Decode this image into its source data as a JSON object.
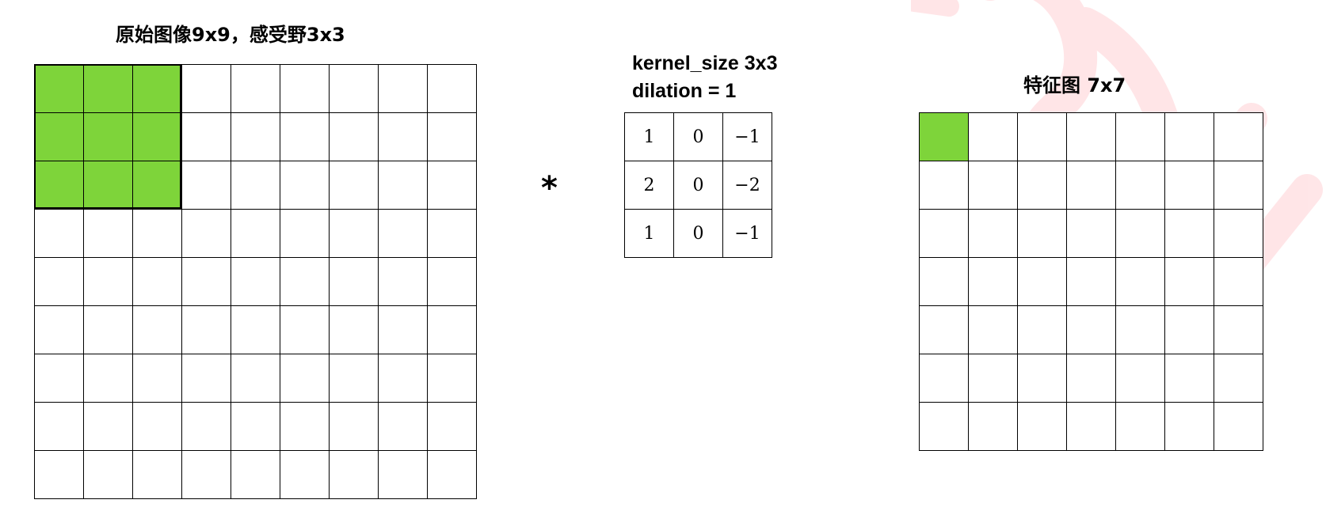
{
  "title_left": "原始图像9x9，感受野3x3",
  "title_right": "特征图 7x7",
  "kernel_size_label": "kernel_size 3x3",
  "dilation_label": "dilation = 1",
  "operator": "*",
  "input_grid": {
    "rows": 9,
    "cols": 9,
    "highlight": {
      "rows": 3,
      "cols": 3
    }
  },
  "kernel_values": [
    [
      "1",
      "0",
      "−1"
    ],
    [
      "2",
      "0",
      "−2"
    ],
    [
      "1",
      "0",
      "−1"
    ]
  ],
  "output_grid": {
    "rows": 7,
    "cols": 7,
    "highlight": {
      "rows": 1,
      "cols": 1
    }
  },
  "colors": {
    "highlight": "#7ed43a",
    "watermark": "#ff3344",
    "line": "#000000"
  }
}
